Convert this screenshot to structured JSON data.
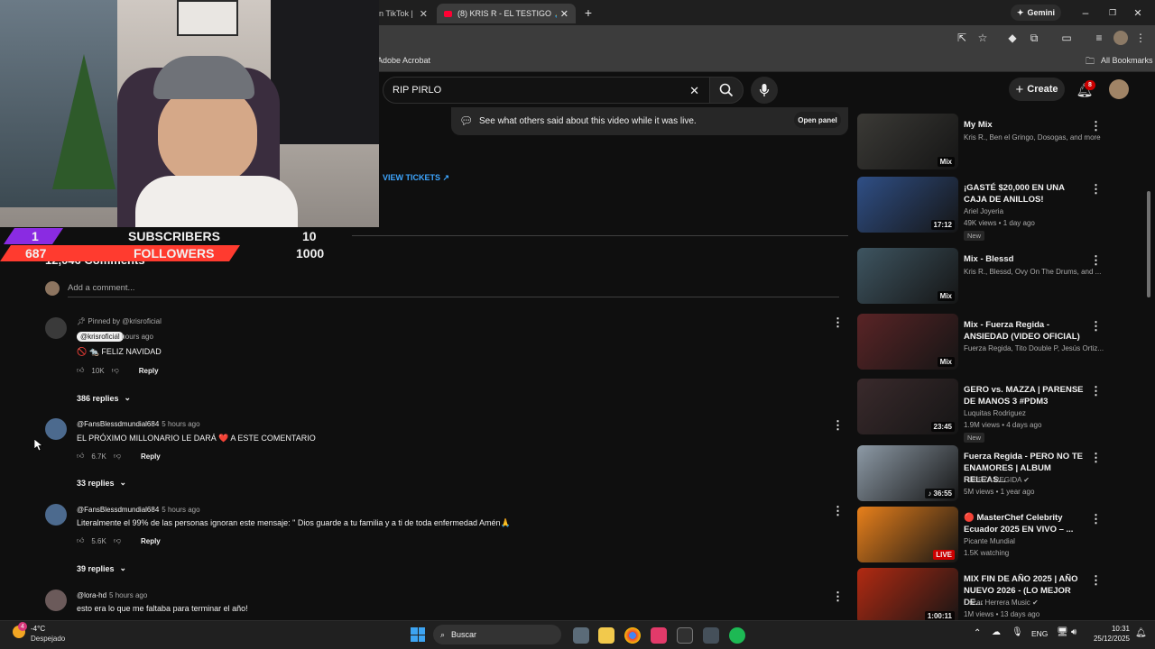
{
  "browser": {
    "tabs": [
      {
        "title": "n TikTok |"
      },
      {
        "title": "(8) KRIS R - EL TESTIGO 🙏 (R"
      }
    ],
    "new_tab": "+",
    "gemini_label": "Gemini",
    "bookmark_left": "Adobe Acrobat",
    "bookmark_all": "All Bookmarks"
  },
  "youtube": {
    "search_value": "RIP PIRLO",
    "create_label": "Create",
    "notif_count": "8"
  },
  "overlay": {
    "subscribers_current": "1",
    "subscribers_label": "SUBSCRIBERS",
    "subscribers_goal": "10",
    "followers_current": "687",
    "followers_label": "FOLLOWERS",
    "followers_goal": "1000",
    "colors": {
      "purple": "#8a2be2",
      "red": "#ff3b2f"
    }
  },
  "chat": {
    "message": "See what others said about this video while it was live.",
    "open_panel": "Open panel"
  },
  "view_tickets": "VIEW TICKETS ↗",
  "comments_header": "12,046 Comments",
  "add_comment_placeholder": "Add a comment...",
  "comments": [
    {
      "pinned": "Pinned by @krisroficial",
      "author": "@krisroficial",
      "time": "5 hours ago",
      "text": "🚫 🐀 FELIZ NAVIDAD",
      "likes": "10K",
      "reply": "Reply",
      "replies": "386 replies"
    },
    {
      "author": "@FansBlessdmundial684",
      "time": "5 hours ago",
      "text": "EL PRÓXIMO MILLONARIO LE DARÁ ❤️ A ESTE COMENTARIO",
      "likes": "6.7K",
      "reply": "Reply",
      "replies": "33 replies"
    },
    {
      "author": "@FansBlessdmundial684",
      "time": "5 hours ago",
      "text": "Literalmente el 99% de las personas ignoran este mensaje: \" Dios guarde a tu familia y a ti de toda enfermedad Amén🙏",
      "likes": "5.6K",
      "reply": "Reply",
      "replies": "39 replies"
    },
    {
      "author": "@lora-hd",
      "time": "5 hours ago",
      "text": "esto era lo que me faltaba para terminar el año!"
    }
  ],
  "recommendations": [
    {
      "title": "My Mix",
      "channel": "Kris R., Ben el Gringo, Dosogas, and more",
      "badge": "Mix",
      "thumb": "#3b3a36"
    },
    {
      "title": "¡GASTÉ $20,000 EN UNA CAJA DE ANILLOS!",
      "channel": "Ariel Joyeria",
      "meta": "49K views • 1 day ago",
      "new": "New",
      "badge": "17:12",
      "thumb": "#2f4f86"
    },
    {
      "title": "Mix - Blessd",
      "channel": "Kris R., Blessd, Ovy On The Drums, and ...",
      "badge": "Mix",
      "thumb": "#3e5561"
    },
    {
      "title": "Mix - Fuerza Regida - ANSIEDAD (VIDEO OFICIAL)",
      "channel": "Fuerza Regida, Tito Double P, Jesús Ortiz...",
      "badge": "Mix",
      "thumb": "#5a2426"
    },
    {
      "title": "GERO vs. MAZZA | PARENSE DE MANOS 3 #PDM3",
      "channel": "Luquitas Rodriguez",
      "meta": "1.9M views • 4 days ago",
      "new": "New",
      "badge": "23:45",
      "thumb": "#3a2a2c"
    },
    {
      "title": "Fuerza Regida - PERO NO TE ENAMORES | ALBUM RELEAS...",
      "channel": "FUERZA REGIDA ✔",
      "meta": "5M views • 1 year ago",
      "badge": "♪ 36:55",
      "thumb": "#8d9aa6"
    },
    {
      "title": "🔴 MasterChef Celebrity Ecuador 2025 EN VIVO – ...",
      "channel": "Picante Mundial",
      "meta": "1.5K watching",
      "badge": "LIVE",
      "thumb": "#e8801b"
    },
    {
      "title": "MIX FIN DE AÑO 2025 | AÑO NUEVO 2026 - (LO MEJOR DE...",
      "channel": "Oscar Herrera Music ✔",
      "meta": "1M views • 13 days ago",
      "badge": "1:00:11",
      "thumb": "#b22a12"
    }
  ],
  "taskbar": {
    "weather_temp": "-4°C",
    "weather_desc": "Despejado",
    "weather_badge": "4",
    "search_label": "Buscar",
    "lang": "ENG",
    "time": "10:31",
    "date": "25/12/2025"
  }
}
